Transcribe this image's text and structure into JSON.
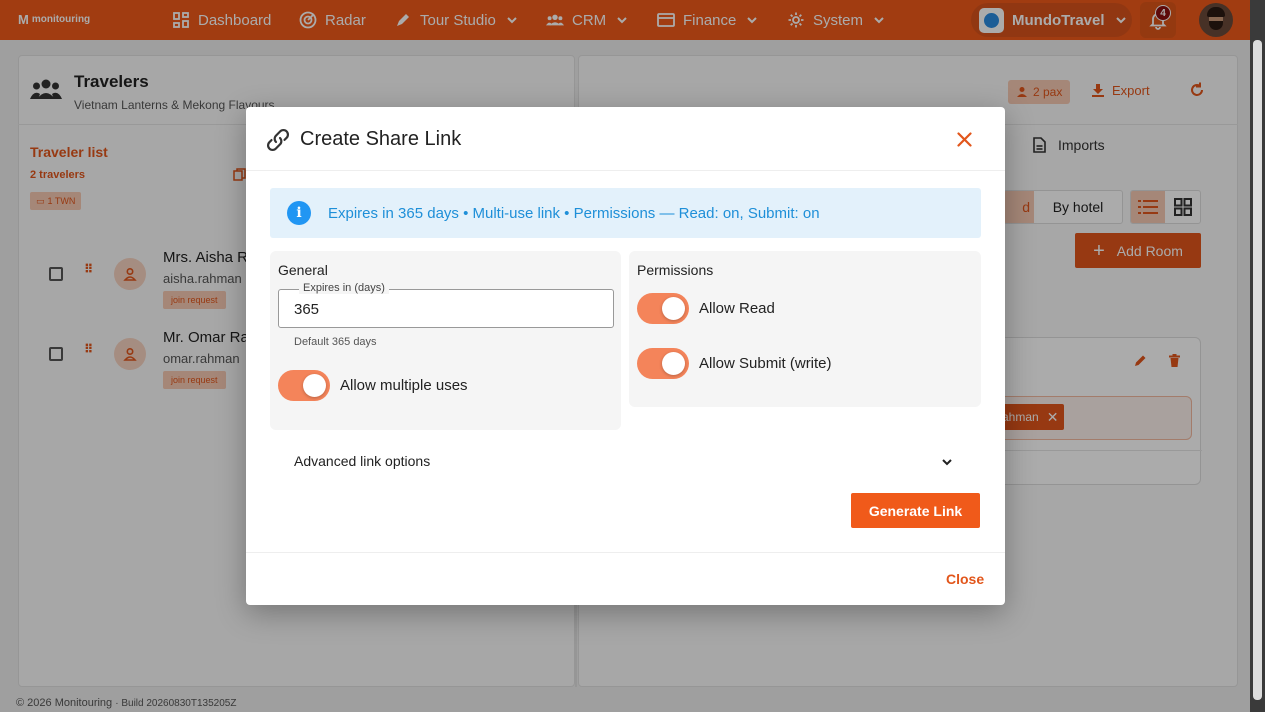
{
  "nav": {
    "brand": "monitouring",
    "items": [
      {
        "label": "Dashboard",
        "icon": "dashboard-icon"
      },
      {
        "label": "Radar",
        "icon": "radar-icon"
      },
      {
        "label": "Tour Studio",
        "icon": "pen-icon"
      },
      {
        "label": "CRM",
        "icon": "people-icon"
      },
      {
        "label": "Finance",
        "icon": "card-icon"
      },
      {
        "label": "System",
        "icon": "gear-icon"
      }
    ],
    "org_name": "MundoTravel",
    "notifications": "4",
    "accent": "#f05a1a"
  },
  "page": {
    "title": "Travelers",
    "subtitle": "Vietnam Lanterns & Mekong Flavours",
    "pax": "2 pax",
    "export": "Export",
    "traveler_list": "Traveler list",
    "traveler_count": "2 travelers",
    "room_badge": "1 TWN",
    "travelers": [
      {
        "name": "Mrs. Aisha R",
        "email": "aisha.rahman",
        "tag": "join request"
      },
      {
        "name": "Mr. Omar Ra",
        "email": "omar.rahman",
        "tag": "join request"
      }
    ],
    "imports": "Imports",
    "seg_partial": "d",
    "by_hotel": "By hotel",
    "add_room": "Add Room",
    "room_chip": "ahman",
    "footer": "© 2026 Monitouring",
    "build": "· Build 20260830T135205Z"
  },
  "modal": {
    "title": "Create Share Link",
    "info": "Expires in 365 days • Multi-use link • Permissions — Read: on, Submit: on",
    "general": {
      "heading": "General",
      "expires_label": "Expires in (days)",
      "expires_value": "365",
      "hint": "Default 365 days",
      "multi_use_label": "Allow multiple uses",
      "multi_use": true
    },
    "permissions": {
      "heading": "Permissions",
      "read_label": "Allow Read",
      "read": true,
      "submit_label": "Allow Submit (write)",
      "submit": true
    },
    "advanced": "Advanced link options",
    "generate": "Generate Link",
    "close": "Close"
  }
}
